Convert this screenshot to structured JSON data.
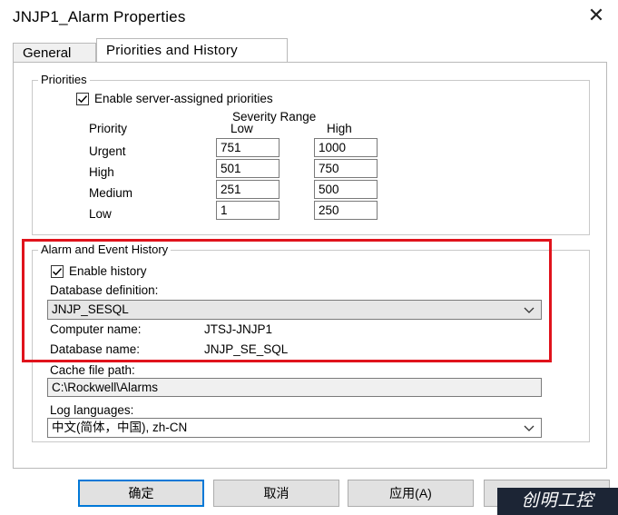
{
  "window": {
    "title": "JNJP1_Alarm Properties",
    "close_glyph": "✕"
  },
  "tabs": [
    {
      "label": "General"
    },
    {
      "label": "Priorities and History"
    }
  ],
  "priorities": {
    "legend": "Priorities",
    "enable_label": "Enable server-assigned priorities",
    "enable_checked": true,
    "severity_range_label": "Severity Range",
    "priority_header": "Priority",
    "low_header": "Low",
    "high_header": "High",
    "rows": [
      {
        "name": "Urgent",
        "low": "751",
        "high": "1000"
      },
      {
        "name": "High",
        "low": "501",
        "high": "750"
      },
      {
        "name": "Medium",
        "low": "251",
        "high": "500"
      },
      {
        "name": "Low",
        "low": "1",
        "high": "250"
      }
    ]
  },
  "history": {
    "legend": "Alarm and Event History",
    "enable_label": "Enable history",
    "enable_checked": true,
    "db_def_label": "Database definition:",
    "db_def_value": "JNJP_SESQL",
    "computer_label": "Computer name:",
    "computer_value": "JTSJ-JNJP1",
    "dbname_label": "Database name:",
    "dbname_value": "JNJP_SE_SQL"
  },
  "cache": {
    "label": "Cache file path:",
    "value": "C:\\Rockwell\\Alarms"
  },
  "log": {
    "label": "Log languages:",
    "value": "中文(简体，中国), zh-CN"
  },
  "buttons": {
    "ok": "确定",
    "cancel": "取消",
    "apply": "应用(A)"
  },
  "watermark": "创明工控",
  "colors": {
    "highlight_box": "#e0131c",
    "default_button_border": "#0078d7",
    "disabled_field_bg": "#f0f0f0"
  }
}
